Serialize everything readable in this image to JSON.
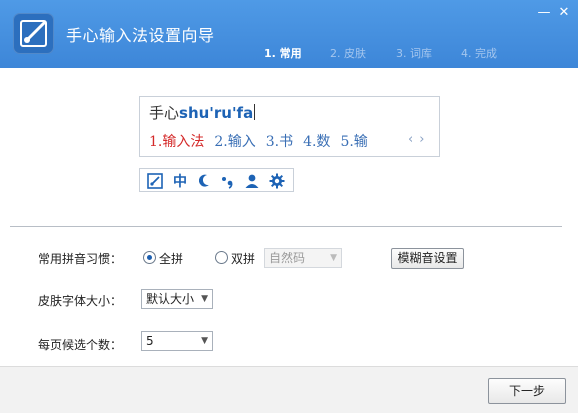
{
  "window": {
    "title": "手心输入法设置向导",
    "minimize_glyph": "—",
    "close_glyph": "✕"
  },
  "steps": [
    {
      "label": "1. 常用",
      "active": true
    },
    {
      "label": "2. 皮肤",
      "active": false
    },
    {
      "label": "3. 词库",
      "active": false
    },
    {
      "label": "4. 完成",
      "active": false
    }
  ],
  "preview": {
    "input_han": "手心",
    "input_pinyin": "shu'ru'fa",
    "candidates": [
      "1.输入法",
      "2.输入",
      "3.书",
      "4.数",
      "5.输"
    ],
    "prev_glyph": "‹",
    "next_glyph": "›"
  },
  "toolbar": {
    "icons": [
      "logo-icon",
      "chinese-mode-icon",
      "half-width-icon",
      "punctuation-icon",
      "user-icon",
      "settings-icon"
    ],
    "chinese_mode_text": "中"
  },
  "settings": {
    "pinyin_habit_label": "常用拼音习惯：",
    "full_pinyin_label": "全拼",
    "double_pinyin_label": "双拼",
    "double_scheme_value": "自然码",
    "fuzzy_button_label": "模糊音设置",
    "font_size_label": "皮肤字体大小：",
    "font_size_value": "默认大小",
    "candidates_label": "每页候选个数：",
    "candidates_value": "5"
  },
  "footer": {
    "next_button_label": "下一步"
  },
  "colors": {
    "header": "#3d86d8",
    "accent": "#1d63b5",
    "first_candidate": "#d42a2a"
  }
}
